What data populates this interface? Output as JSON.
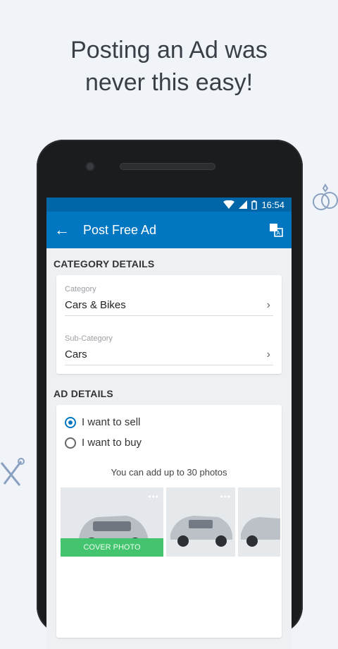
{
  "promo": {
    "line1": "Posting an Ad was",
    "line2": "never this easy!"
  },
  "status": {
    "time": "16:54"
  },
  "appbar": {
    "back": "←",
    "title": "Post Free Ad"
  },
  "category": {
    "section_title": "CATEGORY DETAILS",
    "category_label": "Category",
    "category_value": "Cars & Bikes",
    "subcategory_label": "Sub-Category",
    "subcategory_value": "Cars",
    "chevron": "›"
  },
  "ad": {
    "section_title": "AD DETAILS",
    "options": [
      "I  want  to  sell",
      "I  want  to  buy"
    ],
    "selected": 0,
    "photo_note": "You can add up to 30 photos",
    "cover_label": "COVER PHOTO",
    "more": "•••"
  },
  "colors": {
    "primary": "#0077c0",
    "statusbar": "#0066a8",
    "cover": "#45c46f"
  },
  "icons": [
    "back-arrow-icon",
    "translate-icon",
    "wifi-icon",
    "signal-icon",
    "battery-icon",
    "rings-icon",
    "tools-icon",
    "chevron-right-icon",
    "more-icon"
  ]
}
